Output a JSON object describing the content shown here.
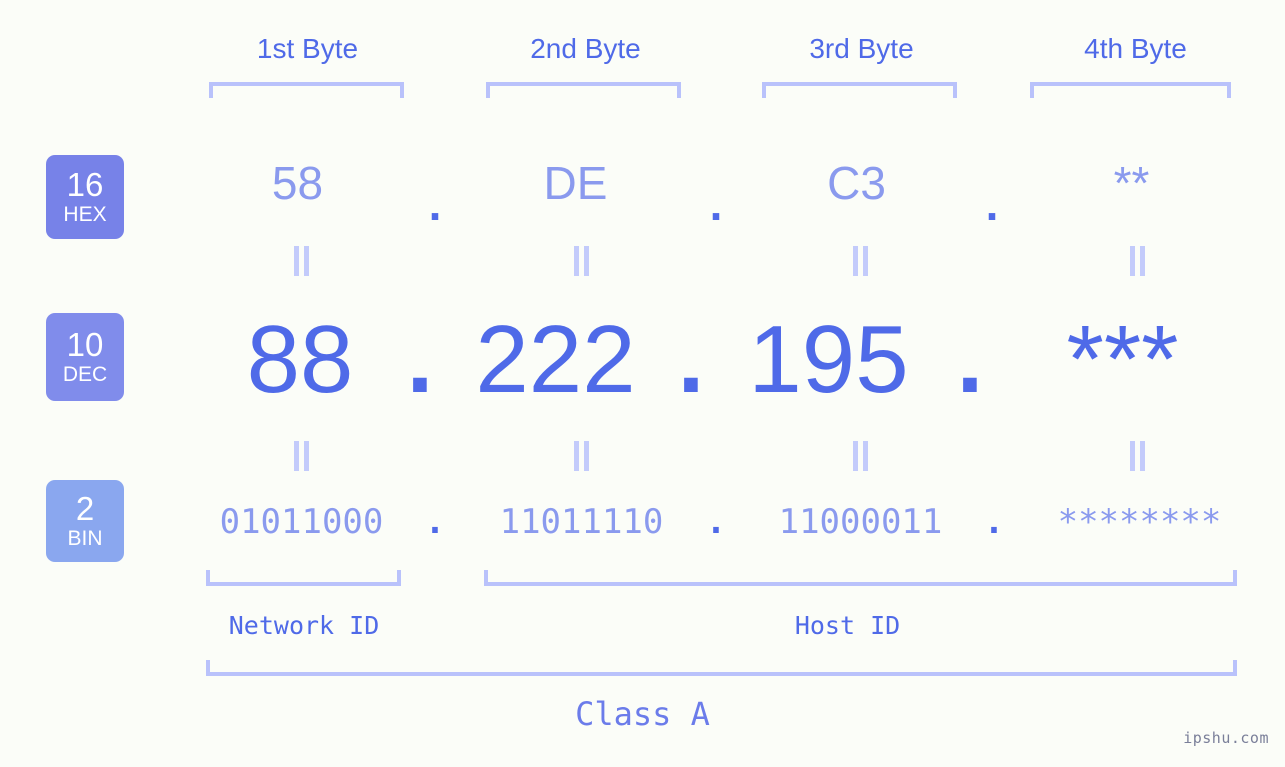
{
  "meta": {
    "background_color": "#fbfdf8",
    "accent_strong": "#4f6ae8",
    "accent_light": "#8a9aee",
    "bracket_color": "#b9c2fb",
    "watermark": "ipshu.com"
  },
  "byte_headers": [
    {
      "label": "1st Byte"
    },
    {
      "label": "2nd Byte"
    },
    {
      "label": "3rd Byte"
    },
    {
      "label": "4th Byte"
    }
  ],
  "rows": [
    {
      "key": "hex",
      "badge": {
        "base": "16",
        "system": "HEX",
        "color": "#7782e8"
      },
      "values": [
        "58",
        "DE",
        "C3",
        "**"
      ],
      "separator": "."
    },
    {
      "key": "dec",
      "badge": {
        "base": "10",
        "system": "DEC",
        "color": "#808ceb"
      },
      "values": [
        "88",
        "222",
        "195",
        "***"
      ],
      "separator": "."
    },
    {
      "key": "bin",
      "badge": {
        "base": "2",
        "system": "BIN",
        "color": "#8aa7ef"
      },
      "values": [
        "01011000",
        "11011110",
        "11000011",
        "********"
      ],
      "separator": "."
    }
  ],
  "equality_marker": "||",
  "segments": [
    {
      "id": "network",
      "label": "Network ID"
    },
    {
      "id": "host",
      "label": "Host ID"
    }
  ],
  "class": {
    "label": "Class A"
  }
}
